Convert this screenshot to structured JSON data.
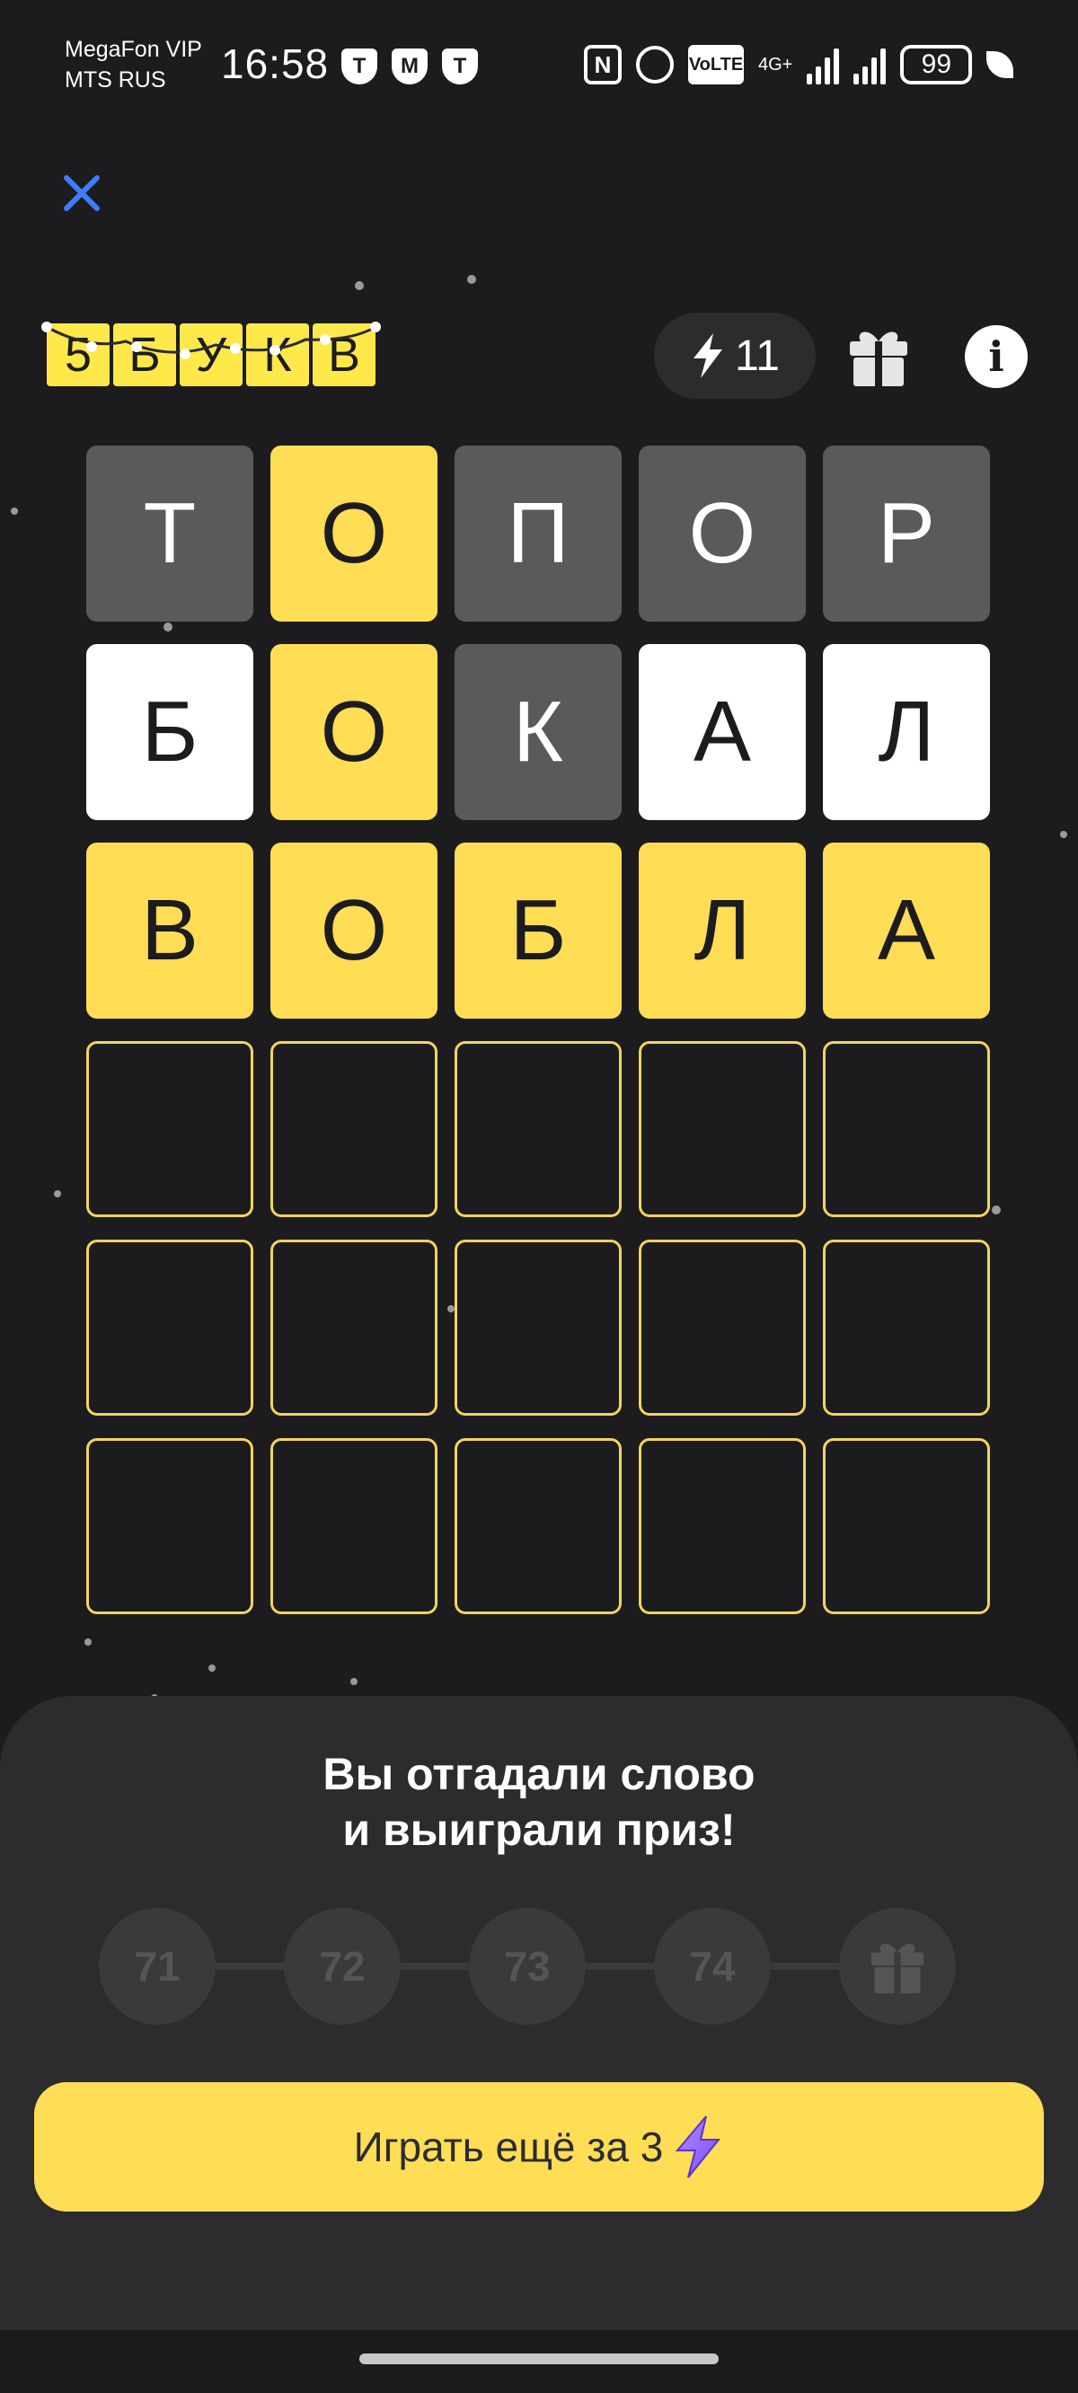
{
  "status_bar": {
    "carrier1": "MegaFon VIP",
    "carrier2": "MTS RUS",
    "time": "16:58",
    "app_icon_1": "Т",
    "app_icon_2": "М",
    "app_icon_3": "Т",
    "nfc": "N",
    "volte": "VoLTE",
    "network": "4G+",
    "battery": "99"
  },
  "header": {
    "logo_letters": [
      "5",
      "Б",
      "У",
      "К",
      "В"
    ],
    "energy_count": "11"
  },
  "colors": {
    "background": "#1c1c1e",
    "yellow": "#ffdd55",
    "gray_tile": "#5a5a5c",
    "white_tile": "#ffffff",
    "close_icon": "#3e7bff"
  },
  "board": {
    "rows": [
      [
        {
          "l": "Т",
          "s": "gray"
        },
        {
          "l": "О",
          "s": "yellow"
        },
        {
          "l": "П",
          "s": "gray"
        },
        {
          "l": "О",
          "s": "gray"
        },
        {
          "l": "Р",
          "s": "gray"
        }
      ],
      [
        {
          "l": "Б",
          "s": "white"
        },
        {
          "l": "О",
          "s": "yellow"
        },
        {
          "l": "К",
          "s": "gray"
        },
        {
          "l": "А",
          "s": "white"
        },
        {
          "l": "Л",
          "s": "white"
        }
      ],
      [
        {
          "l": "В",
          "s": "yellow"
        },
        {
          "l": "О",
          "s": "yellow"
        },
        {
          "l": "Б",
          "s": "yellow"
        },
        {
          "l": "Л",
          "s": "yellow"
        },
        {
          "l": "А",
          "s": "yellow"
        }
      ],
      [
        {
          "l": "",
          "s": "empty"
        },
        {
          "l": "",
          "s": "empty"
        },
        {
          "l": "",
          "s": "empty"
        },
        {
          "l": "",
          "s": "empty"
        },
        {
          "l": "",
          "s": "empty"
        }
      ],
      [
        {
          "l": "",
          "s": "empty"
        },
        {
          "l": "",
          "s": "empty"
        },
        {
          "l": "",
          "s": "empty"
        },
        {
          "l": "",
          "s": "empty"
        },
        {
          "l": "",
          "s": "empty"
        }
      ],
      [
        {
          "l": "",
          "s": "empty"
        },
        {
          "l": "",
          "s": "empty"
        },
        {
          "l": "",
          "s": "empty"
        },
        {
          "l": "",
          "s": "empty"
        },
        {
          "l": "",
          "s": "empty"
        }
      ]
    ]
  },
  "result": {
    "title_line1": "Вы отгадали слово",
    "title_line2": "и выиграли приз!",
    "steps": [
      "71",
      "72",
      "73",
      "74"
    ],
    "play_again_label": "Играть ещё за 3"
  }
}
